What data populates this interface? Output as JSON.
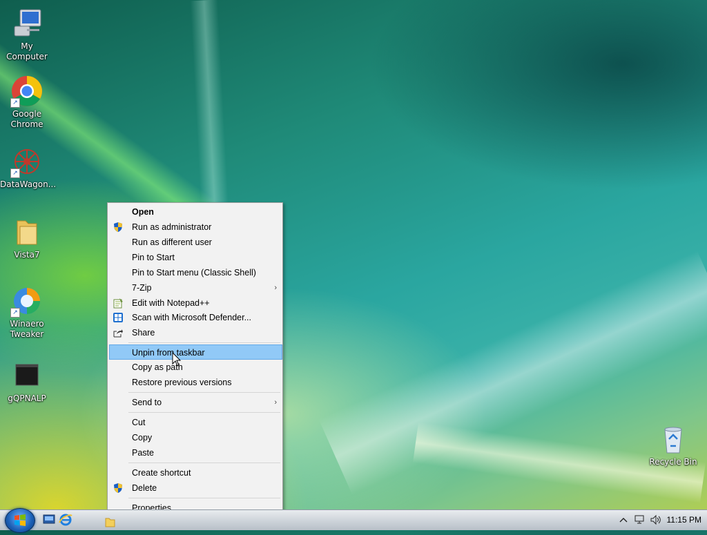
{
  "desktop": {
    "icons": [
      {
        "label": "My Computer",
        "icon": "computer-icon"
      },
      {
        "label": "Google Chrome",
        "icon": "chrome-icon"
      },
      {
        "label": "DataWagon...",
        "icon": "datawagon-icon"
      },
      {
        "label": "Vista7",
        "icon": "folder-icon"
      },
      {
        "label": "Winaero Tweaker",
        "icon": "winaero-tweaker-icon"
      },
      {
        "label": "gQPNALP",
        "icon": "app-icon"
      },
      {
        "label": "Recycle Bin",
        "icon": "recycle-bin-icon"
      }
    ]
  },
  "context_menu": {
    "items": [
      {
        "label": "Open",
        "bold": true
      },
      {
        "label": "Run as administrator",
        "icon": "uac-shield-icon"
      },
      {
        "label": "Run as different user"
      },
      {
        "label": "Pin to Start"
      },
      {
        "label": "Pin to Start menu (Classic Shell)"
      },
      {
        "label": "7-Zip",
        "submenu": true
      },
      {
        "label": "Edit with Notepad++",
        "icon": "notepad-plus-plus-icon"
      },
      {
        "label": "Scan with Microsoft Defender...",
        "icon": "defender-icon"
      },
      {
        "label": "Share",
        "icon": "share-icon"
      },
      {
        "label": "Unpin from taskbar",
        "highlighted": true
      },
      {
        "label": "Copy as path"
      },
      {
        "label": "Restore previous versions"
      },
      {
        "label": "Send to",
        "submenu": true
      },
      {
        "label": "Cut"
      },
      {
        "label": "Copy"
      },
      {
        "label": "Paste"
      },
      {
        "label": "Create shortcut"
      },
      {
        "label": "Delete",
        "icon": "uac-shield-icon"
      },
      {
        "label": "Properties"
      }
    ],
    "submenu_arrow": "›"
  },
  "taskbar": {
    "clock": "11:15 PM",
    "tray_icons": [
      "chevron-up-icon",
      "network-icon",
      "volume-icon"
    ],
    "pinned": [
      "start-orb-icon",
      "show-desktop-icon",
      "internet-explorer-icon",
      "folder-icon"
    ]
  }
}
